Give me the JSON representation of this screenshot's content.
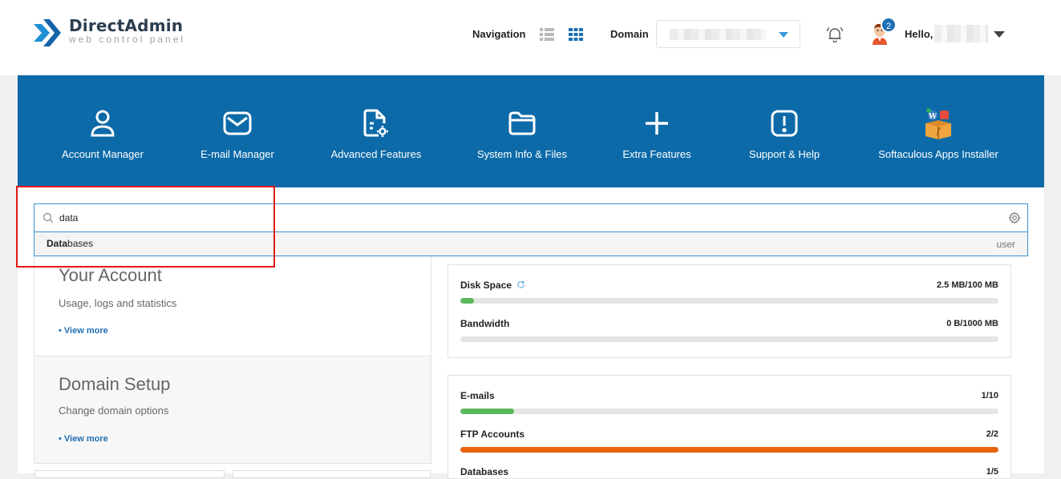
{
  "header": {
    "logo_title": "DirectAdmin",
    "logo_subtitle": "web control panel",
    "navigation_label": "Navigation",
    "domain_label": "Domain",
    "notification_count": "2",
    "hello_label": "Hello,"
  },
  "menu": [
    {
      "label": "Account Manager",
      "icon": "user-icon"
    },
    {
      "label": "E-mail Manager",
      "icon": "envelope-icon"
    },
    {
      "label": "Advanced Features",
      "icon": "document-gear-icon"
    },
    {
      "label": "System Info & Files",
      "icon": "folder-icon"
    },
    {
      "label": "Extra Features",
      "icon": "plus-icon"
    },
    {
      "label": "Support & Help",
      "icon": "exclamation-icon"
    },
    {
      "label": "Softaculous Apps Installer",
      "icon": "softaculous-icon"
    }
  ],
  "search": {
    "value": "data",
    "suggestion_match": "Data",
    "suggestion_rest": "bases",
    "suggestion_role": "user"
  },
  "panels": [
    {
      "title": "Your Account",
      "subtitle": "Usage, logs and statistics",
      "more": "• View more"
    },
    {
      "title": "Domain Setup",
      "subtitle": "Change domain options",
      "more": "• View more"
    }
  ],
  "stats_group1": [
    {
      "label": "Disk Space",
      "value": "2.5 MB/100 MB",
      "fraction": 0.025,
      "color": "#5cb85c"
    },
    {
      "label": "Bandwidth",
      "value": "0 B/1000 MB",
      "fraction": 0.0,
      "color": "#5cb85c"
    }
  ],
  "stats_group2": [
    {
      "label": "E-mails",
      "value": "1/10",
      "fraction": 0.1,
      "color": "#5cb85c"
    },
    {
      "label": "FTP Accounts",
      "value": "2/2",
      "fraction": 1.0,
      "color": "#e8630a"
    },
    {
      "label": "Databases",
      "value": "1/5",
      "fraction": 0.2,
      "color": "#5cb85c"
    }
  ],
  "colors": {
    "brand_blue": "#0d6aa8",
    "link_blue": "#1d6fb2",
    "highlight_red": "#e01818"
  }
}
